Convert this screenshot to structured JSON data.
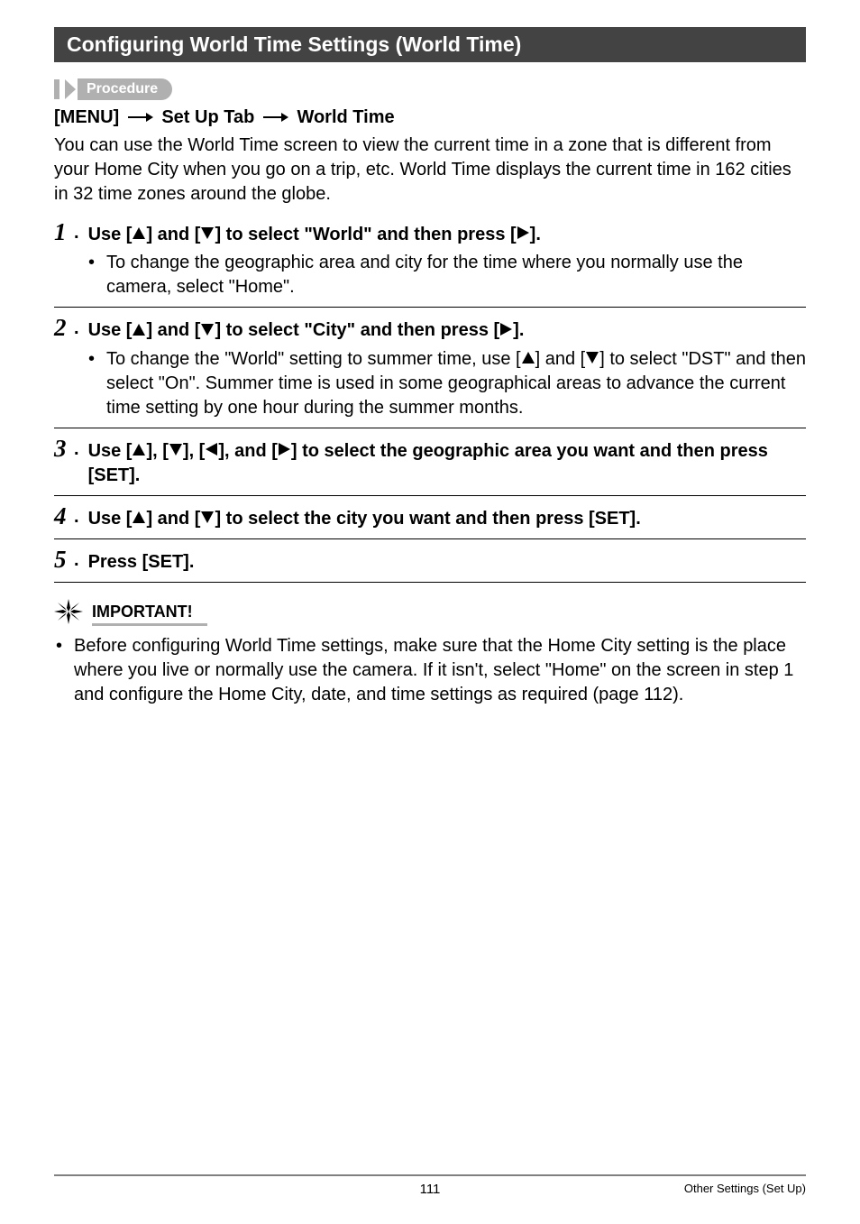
{
  "header": "Configuring World Time Settings (World Time)",
  "procedure_label": "Procedure",
  "menu_path": {
    "part1": "[MENU]",
    "part2": "Set Up Tab",
    "part3": "World Time"
  },
  "intro": "You can use the World Time screen to view the current time in a zone that is different from your Home City when you go on a trip, etc. World Time displays the current time in 162 cities in 32 time zones around the globe.",
  "steps": [
    {
      "num": "1",
      "text_pre": "Use [",
      "text_mid1": "] and [",
      "text_mid2": "] to select \"World\" and then press [",
      "text_post": "].",
      "bullet": "To change the geographic area and city for the time where you normally use the camera, select \"Home\"."
    },
    {
      "num": "2",
      "text_pre": "Use [",
      "text_mid1": "] and [",
      "text_mid2": "] to select \"City\" and then press [",
      "text_post": "].",
      "bullet_pre": "To change the \"World\" setting to summer time, use [",
      "bullet_mid": "] and [",
      "bullet_post": "] to select \"DST\" and then select \"On\". Summer time is used in some geographical areas to advance the current time setting by one hour during the summer months."
    },
    {
      "num": "3",
      "text_pre": "Use [",
      "text_a": "], [",
      "text_b": "], [",
      "text_c": "], and [",
      "text_post": "] to select the geographic area you want and then press [SET]."
    },
    {
      "num": "4",
      "text_pre": "Use [",
      "text_mid1": "] and [",
      "text_post": "] to select the city you want and then press [SET]."
    },
    {
      "num": "5",
      "text": "Press [SET]."
    }
  ],
  "important": {
    "label": "IMPORTANT!",
    "text": "Before configuring World Time settings, make sure that the Home City setting is the place where you live or normally use the camera. If it isn't, select \"Home\" on the screen in step 1 and configure the Home City, date, and time settings as required (page 112)."
  },
  "footer": {
    "page": "111",
    "section": "Other Settings (Set Up)"
  }
}
